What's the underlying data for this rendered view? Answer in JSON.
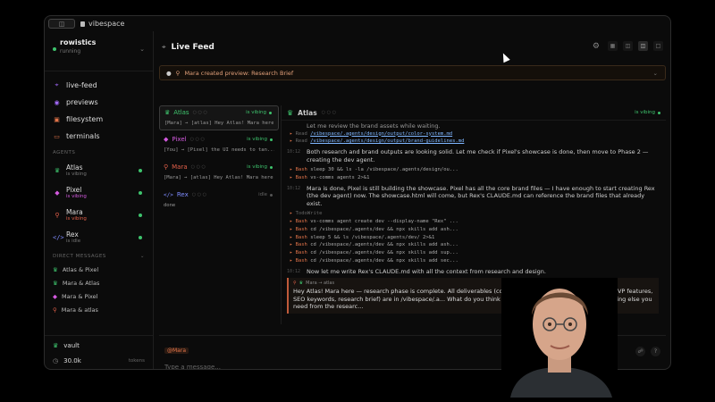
{
  "app": {
    "title": "vibespace"
  },
  "workspace": {
    "name": "rowistics",
    "status": "running"
  },
  "nav": [
    {
      "label": "live-feed",
      "icon": "pulse-icon",
      "color": "#a56bff"
    },
    {
      "label": "previews",
      "icon": "eye-icon",
      "color": "#a56bff"
    },
    {
      "label": "filesystem",
      "icon": "folder-icon",
      "color": "#e2744a"
    },
    {
      "label": "terminals",
      "icon": "terminal-icon",
      "color": "#e2744a"
    }
  ],
  "sections": {
    "agents": "AGENTS",
    "direct": "DIRECT MESSAGES"
  },
  "agents": [
    {
      "name": "Atlas",
      "status": "is vibing",
      "icon": "crown-icon",
      "color": "#3ec46d"
    },
    {
      "name": "Pixel",
      "status": "is vibing",
      "icon": "palette-icon",
      "color": "#d45adf"
    },
    {
      "name": "Mara",
      "status": "is vibing",
      "icon": "search-icon",
      "color": "#e2604a"
    },
    {
      "name": "Rex",
      "status": "is idle",
      "icon": "code-icon",
      "color": "#7f8cff"
    }
  ],
  "dms": [
    "Atlas & Pixel",
    "Mara & Atlas",
    "Mara & Pixel",
    "Mara & atlas"
  ],
  "bottom": {
    "vault": "vault",
    "tokens_value": "30.0k",
    "tokens_label": "tokens"
  },
  "header": {
    "title": "Live Feed"
  },
  "banner": {
    "text": "Mara created preview: Research Brief"
  },
  "cards": [
    {
      "name": "Atlas",
      "status": "is vibing",
      "msg": "[Mara] → [atlas] Hey Atlas! Mara here — rese...",
      "color": "#3ec46d"
    },
    {
      "name": "Pixel",
      "status": "is vibing",
      "msg": "[You] → [Pixel] the UI needs to tan...",
      "color": "#d45adf"
    },
    {
      "name": "Mara",
      "status": "is vibing",
      "msg": "[Mara] → [atlas] Hey Atlas! Mara here — rese...",
      "color": "#e2604a"
    },
    {
      "name": "Rex",
      "status": "idle",
      "msg": "done",
      "color": "#7f8cff"
    }
  ],
  "detail": {
    "name": "Atlas",
    "status": "is vibing",
    "log": {
      "l0": "Let me review the brand assets while waiting.",
      "r1": "Read",
      "r1path": "/vibespace/.agents/design/output/color-system.md",
      "r2": "Read",
      "r2path": "/vibespace/.agents/design/output/brand-guidelines.md",
      "t1": "10:12",
      "m1": "Both research and brand outputs are looking solid. Let me check if Pixel's showcase is done, then move to Phase 2 — creating the dev agent.",
      "b1": "sleep 30 && ls -la /vibespace/.agents/design/ou...",
      "b2": "vs-comms agents 2>&1",
      "t2": "10:12",
      "m2": "Mara is done, Pixel is still building the showcase. Pixel has all the core brand files — I have enough to start creating Rex (the dev agent) now. The showcase.html will come, but Rex's CLAUDE.md can reference the brand files that already exist.",
      "todo": "TodoWrite",
      "b3": "vs-comms agent create dev --display-name \"Rex\" ...",
      "b4": "cd /vibespace/.agents/dev && npx skills add ash...",
      "b5": "sleep 5 && ls /vibespace/.agents/dev/ 2>&1",
      "b6": "cd /vibespace/.agents/dev && npx skills add ash...",
      "b7": "cd /vibespace/.agents/dev && npx skills add sup...",
      "b8": "cd /vibespace/.agents/dev && npx skills add sec...",
      "t3": "10:12",
      "m3": "Now let me write Rex's CLAUDE.md with all the context from research and design.",
      "bash": "Bash",
      "msg_head": "Mara → atlas",
      "msg_body": "Hey Atlas! Mara here — research phase is complete. All deliverables (comp... positioning, landing page copy, MVP features, SEO keywords, research brief) are in /vibespace/.a... What do you think the next steps should be for me? Anything else you need from the researc..."
    }
  },
  "composer": {
    "mention": "@Mara",
    "placeholder": "Type a message..."
  }
}
